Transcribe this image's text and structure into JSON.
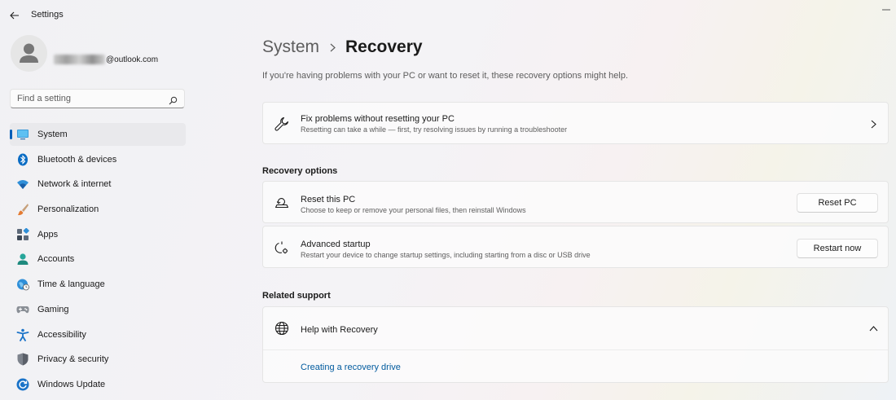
{
  "window": {
    "title": "Settings"
  },
  "account": {
    "email_suffix": "@outlook.com"
  },
  "search": {
    "placeholder": "Find a setting"
  },
  "nav": {
    "items": [
      {
        "label": "System",
        "icon": "system-icon",
        "active": true
      },
      {
        "label": "Bluetooth & devices",
        "icon": "bluetooth-icon"
      },
      {
        "label": "Network & internet",
        "icon": "wifi-icon"
      },
      {
        "label": "Personalization",
        "icon": "brush-icon"
      },
      {
        "label": "Apps",
        "icon": "apps-icon"
      },
      {
        "label": "Accounts",
        "icon": "accounts-icon"
      },
      {
        "label": "Time & language",
        "icon": "globe-clock-icon"
      },
      {
        "label": "Gaming",
        "icon": "gamepad-icon"
      },
      {
        "label": "Accessibility",
        "icon": "accessibility-icon"
      },
      {
        "label": "Privacy & security",
        "icon": "shield-icon"
      },
      {
        "label": "Windows Update",
        "icon": "update-icon"
      }
    ]
  },
  "page": {
    "breadcrumb_parent": "System",
    "breadcrumb_current": "Recovery",
    "intro": "If you're having problems with your PC or want to reset it, these recovery options might help."
  },
  "fix": {
    "title": "Fix problems without resetting your PC",
    "desc": "Resetting can take a while — first, try resolving issues by running a troubleshooter"
  },
  "recovery_options": {
    "heading": "Recovery options",
    "reset": {
      "title": "Reset this PC",
      "desc": "Choose to keep or remove your personal files, then reinstall Windows",
      "button": "Reset PC"
    },
    "advanced": {
      "title": "Advanced startup",
      "desc": "Restart your device to change startup settings, including starting from a disc or USB drive",
      "button": "Restart now"
    }
  },
  "related_support": {
    "heading": "Related support",
    "help_title": "Help with Recovery",
    "link": "Creating a recovery drive"
  },
  "colors": {
    "accent": "#005fb8",
    "link": "#005a9e"
  }
}
